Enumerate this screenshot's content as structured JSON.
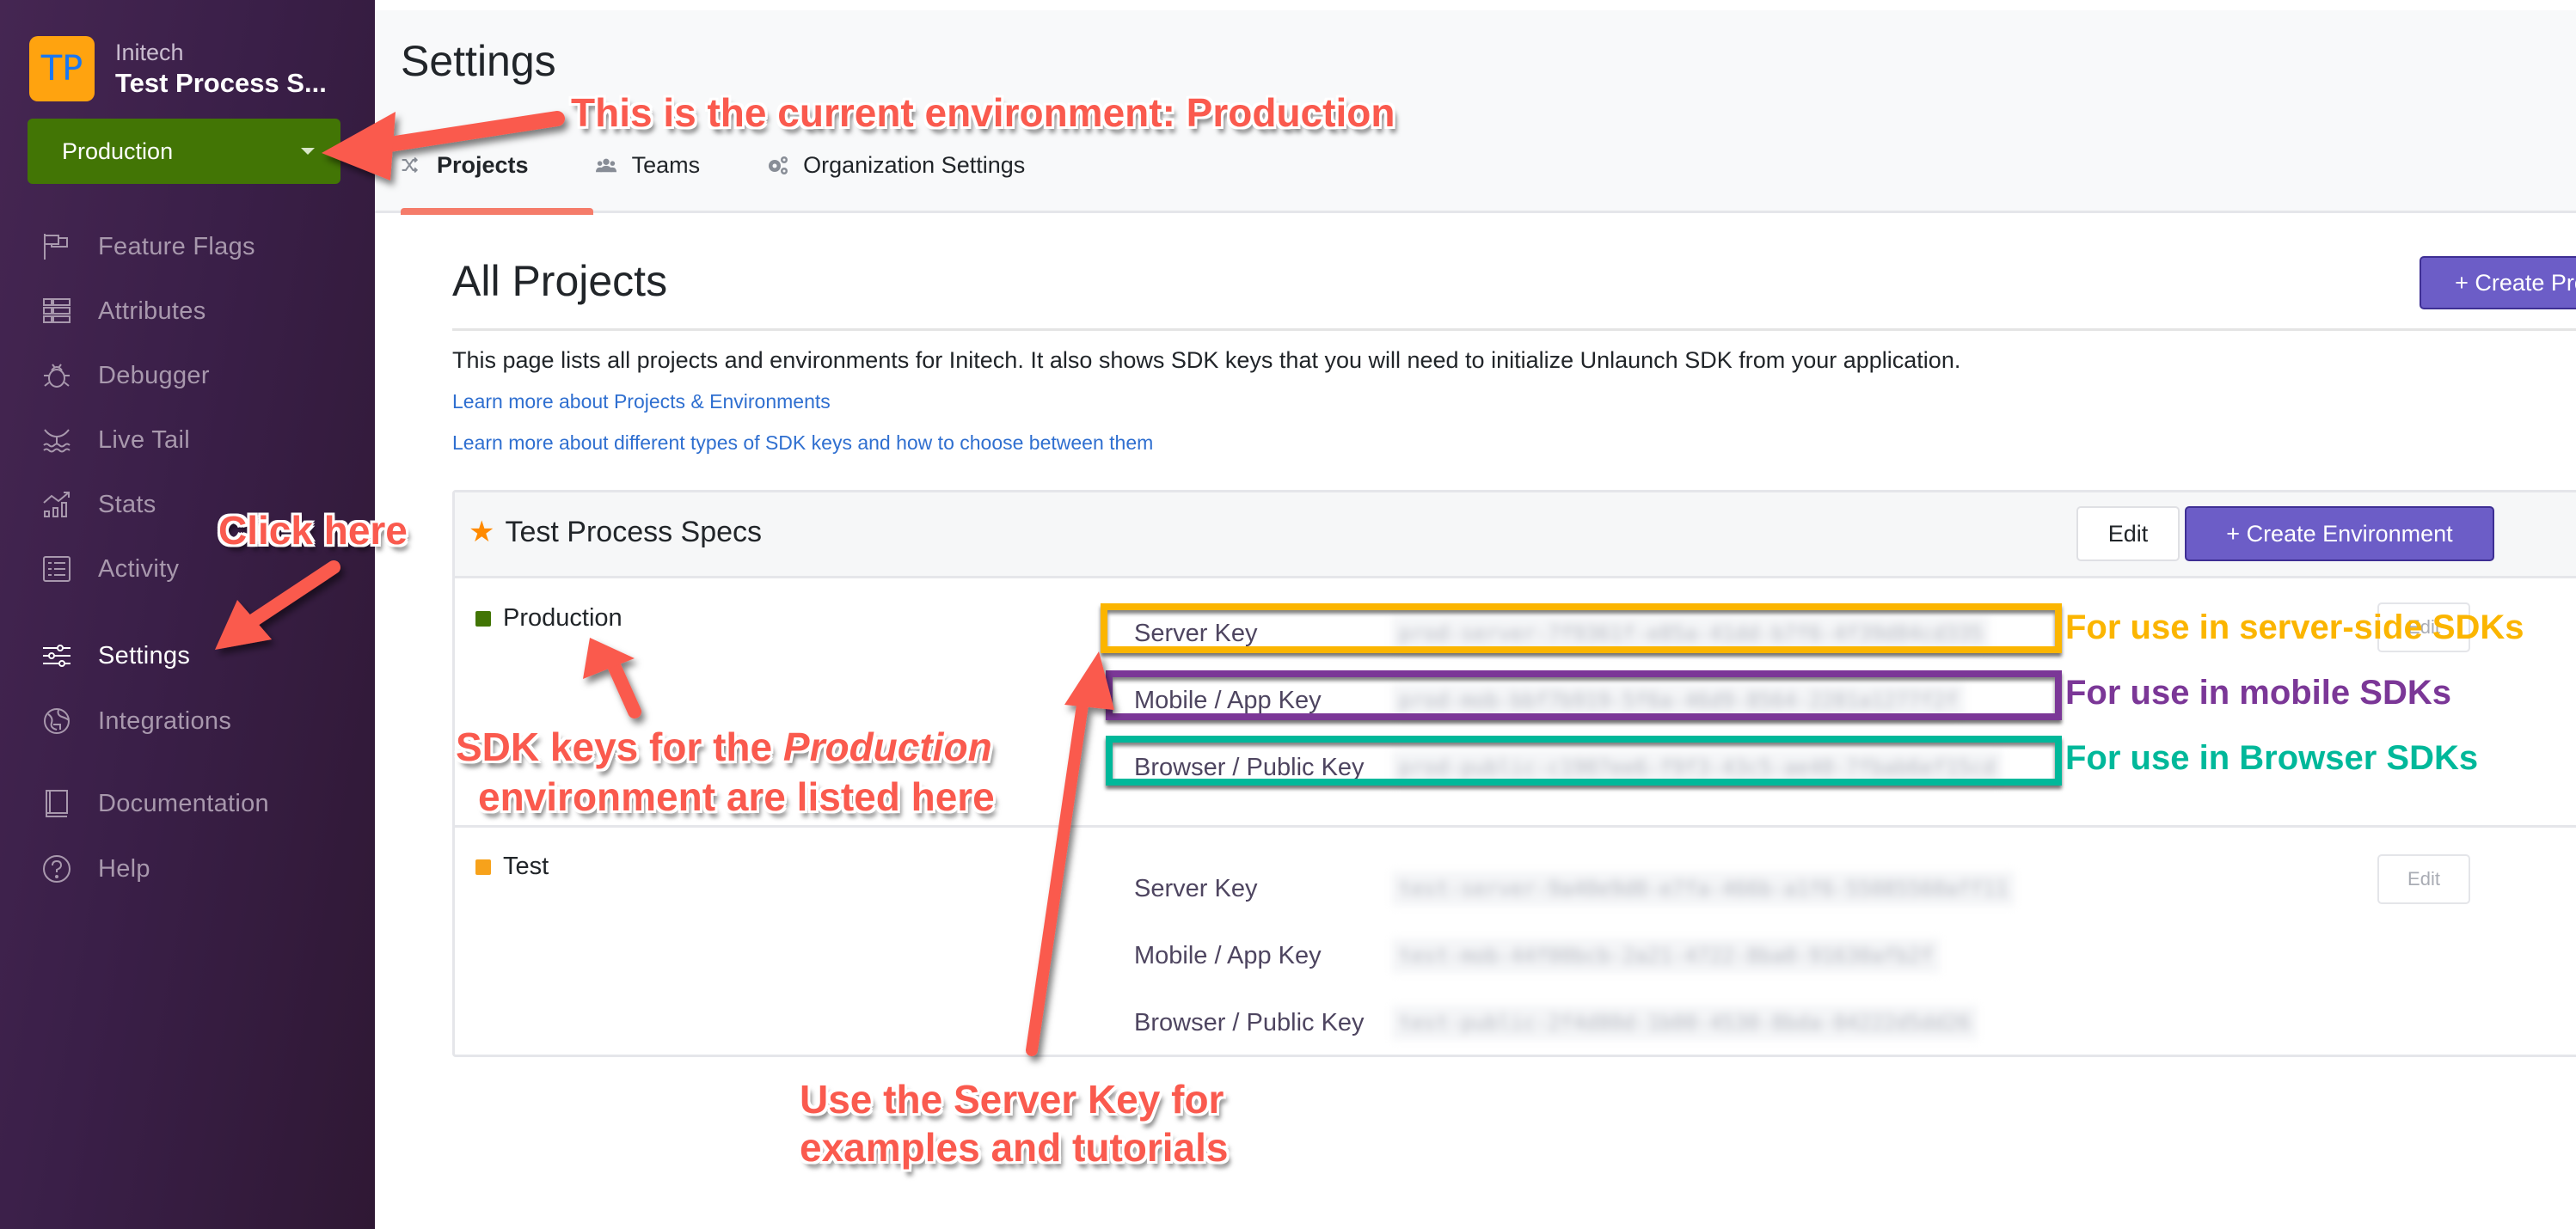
{
  "sidebar": {
    "org_avatar": "TP",
    "org_name": "Initech",
    "project_name": "Test Process S...",
    "environment_selector": "Production",
    "items": [
      {
        "label": "Feature Flags",
        "icon": "flag-icon"
      },
      {
        "label": "Attributes",
        "icon": "attributes-icon"
      },
      {
        "label": "Debugger",
        "icon": "bug-icon"
      },
      {
        "label": "Live Tail",
        "icon": "whale-tail-icon"
      },
      {
        "label": "Stats",
        "icon": "stats-icon"
      },
      {
        "label": "Activity",
        "icon": "activity-list-icon"
      },
      {
        "label": "Settings",
        "icon": "sliders-icon",
        "active": true
      },
      {
        "label": "Integrations",
        "icon": "puzzle-globe-icon"
      },
      {
        "label": "Documentation",
        "icon": "book-icon"
      },
      {
        "label": "Help",
        "icon": "question-circle-icon"
      }
    ]
  },
  "header": {
    "title": "Settings",
    "tabs": [
      {
        "label": "Projects",
        "icon": "shuffle-icon",
        "active": true
      },
      {
        "label": "Teams",
        "icon": "users-icon"
      },
      {
        "label": "Organization Settings",
        "icon": "cogs-icon"
      }
    ]
  },
  "content": {
    "title": "All Projects",
    "create_project_label": "+ Create Project",
    "description": "This page lists all projects and environments for Initech. It also shows SDK keys that you will need to initialize Unlaunch SDK from your application.",
    "links": [
      "Learn more about Projects & Environments",
      "Learn more about different types of SDK keys and how to choose between them"
    ],
    "project": {
      "name": "Test Process Specs",
      "edit_label": "Edit",
      "create_environment_label": "+ Create Environment",
      "environments": [
        {
          "name": "Production",
          "color": "#427505",
          "edit_label": "Edit",
          "keys": [
            {
              "label": "Server Key",
              "value": "prod-server-7f9361f-e85a-41dd-b7f6-4f39d84cd335"
            },
            {
              "label": "Mobile / App Key",
              "value": "prod-mob-bbf7b919-5f6a-46d9-8564-2281a1277f2f"
            },
            {
              "label": "Browser / Public Key",
              "value": "prod-public-c1907ee6-f9f3-43c5-ae40-7fbab6ef15cd"
            }
          ]
        },
        {
          "name": "Test",
          "color": "#f7a21b",
          "edit_label": "Edit",
          "keys": [
            {
              "label": "Server Key",
              "value": "test-server-9a40e9d0-e7fa-466b-a1f6-55085560aff11"
            },
            {
              "label": "Mobile / App Key",
              "value": "test-mob-44f00bcb-2a21-4722-8ba0-91630afb2f"
            },
            {
              "label": "Browser / Public Key",
              "value": "test-public-2f4d80d-1b00-4530-8bda-04222d5dd26"
            }
          ]
        }
      ]
    }
  },
  "annotations": {
    "current_env": "This is the current environment: Production",
    "click_here": "Click here",
    "sdk_keys_prefix": "SDK keys for the ",
    "sdk_keys_italic": "Production",
    "sdk_keys_line2": "environment are listed here",
    "server_side": "For use in server-side SDKs",
    "mobile": "For use in mobile SDKs",
    "browser": "For use in Browser SDKs",
    "use_server_line1": "Use the Server Key for",
    "use_server_line2": "examples and tutorials",
    "colors": {
      "red": "#fa5a4e",
      "server_box": "#fbb500",
      "mobile_box": "#7b3797",
      "browser_box": "#00b89a"
    }
  }
}
